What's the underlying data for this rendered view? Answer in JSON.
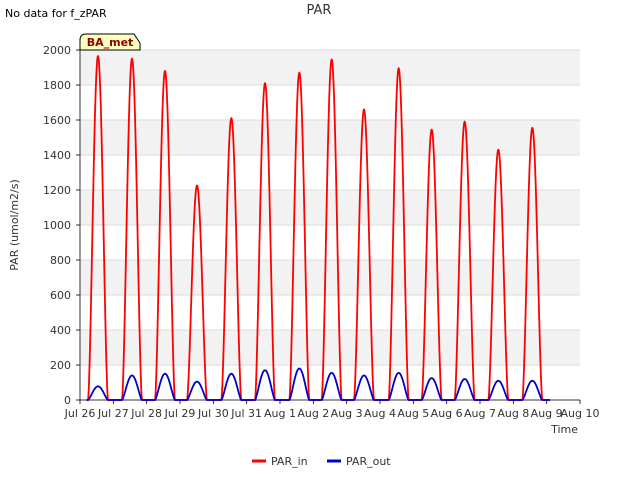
{
  "page": {
    "no_data_note": "No data for f_zPAR"
  },
  "chart_data": {
    "type": "line",
    "title": "PAR",
    "xlabel": "Time",
    "ylabel": "PAR (umol/m2/s)",
    "annotation_box": "BA_met",
    "x_domain": [
      "Jul 26",
      "Aug 10"
    ],
    "ylim": [
      0,
      2000
    ],
    "yticks": [
      0,
      200,
      400,
      600,
      800,
      1000,
      1200,
      1400,
      1600,
      1800,
      2000
    ],
    "xtick_labels": [
      "Jul 26",
      "Jul 27",
      "Jul 28",
      "Jul 29",
      "Jul 30",
      "Jul 31",
      "Aug 1",
      "Aug 2",
      "Aug 3",
      "Aug 4",
      "Aug 5",
      "Aug 6",
      "Aug 7",
      "Aug 8",
      "Aug 9",
      "Aug 10"
    ],
    "grid": true,
    "legend_position": "bottom-center",
    "series": [
      {
        "name": "PAR_in",
        "color": "#ff0000",
        "daily_peak_day": [
          0.54,
          1.56,
          2.55,
          3.51,
          4.54,
          5.55,
          6.58,
          7.55,
          8.52,
          9.56,
          10.55,
          11.54,
          12.55,
          13.57
        ],
        "daily_peak_value": [
          1965,
          1950,
          1880,
          1225,
          1610,
          1810,
          1870,
          1945,
          1660,
          1895,
          1545,
          1590,
          1430,
          1555
        ]
      },
      {
        "name": "PAR_out",
        "color": "#0000cc",
        "daily_peak_day": [
          0.54,
          1.56,
          2.55,
          3.51,
          4.54,
          5.55,
          6.58,
          7.55,
          8.52,
          9.56,
          10.55,
          11.54,
          12.55,
          13.57
        ],
        "daily_peak_value": [
          78,
          140,
          150,
          105,
          150,
          170,
          180,
          155,
          140,
          155,
          125,
          120,
          110,
          110
        ]
      }
    ]
  }
}
